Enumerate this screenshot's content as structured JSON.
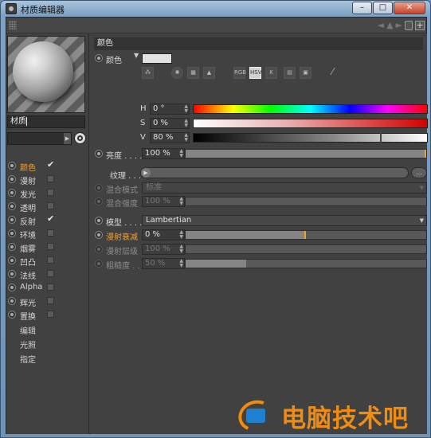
{
  "window": {
    "title": "材质编辑器",
    "buttons": {
      "minimize": "–",
      "maximize": "□",
      "close": "✕"
    }
  },
  "material": {
    "name": "材质"
  },
  "channels": [
    {
      "label": "颜色",
      "checked": true,
      "active": true
    },
    {
      "label": "漫射",
      "checked": false
    },
    {
      "label": "发光",
      "checked": false
    },
    {
      "label": "透明",
      "checked": false
    },
    {
      "label": "反射",
      "checked": true
    },
    {
      "label": "环境",
      "checked": false
    },
    {
      "label": "烟雾",
      "checked": false
    },
    {
      "label": "凹凸",
      "checked": false
    },
    {
      "label": "法线",
      "checked": false
    },
    {
      "label": "Alpha",
      "checked": false
    },
    {
      "label": "辉光",
      "checked": false
    },
    {
      "label": "置换",
      "checked": false
    }
  ],
  "extra_items": [
    "编辑",
    "光照",
    "指定"
  ],
  "section": {
    "title": "颜色"
  },
  "color": {
    "label": "颜色",
    "swatch_hex": "#e2e2e2",
    "modes": [
      "RGB",
      "HSV",
      "K"
    ],
    "selected_mode": "HSV",
    "h": {
      "label": "H",
      "value": "0 °"
    },
    "s": {
      "label": "S",
      "value": "0 %"
    },
    "v": {
      "label": "V",
      "value": "80 %",
      "level": 0.8
    }
  },
  "brightness": {
    "label": "亮度 . . . . . .",
    "value": "100 %",
    "level": 1.0
  },
  "texture": {
    "label": "纹理 . . . . .",
    "more": "..."
  },
  "mix_mode": {
    "label": "混合模式",
    "value": "标准"
  },
  "mix_strength": {
    "label": "混合强度",
    "value": "100 %"
  },
  "model": {
    "label": "模型 . . . . . .",
    "value": "Lambertian"
  },
  "diffuse_falloff": {
    "label": "漫射衰减",
    "value": "0 %",
    "level": 0.5
  },
  "diffuse_level": {
    "label": "漫射层级",
    "value": "100 %"
  },
  "roughness": {
    "label": "粗糙度 . .",
    "value": "50 %",
    "level": 0.25
  },
  "watermark": {
    "text": "电脑技术吧"
  },
  "accent_color": "#f0a030"
}
